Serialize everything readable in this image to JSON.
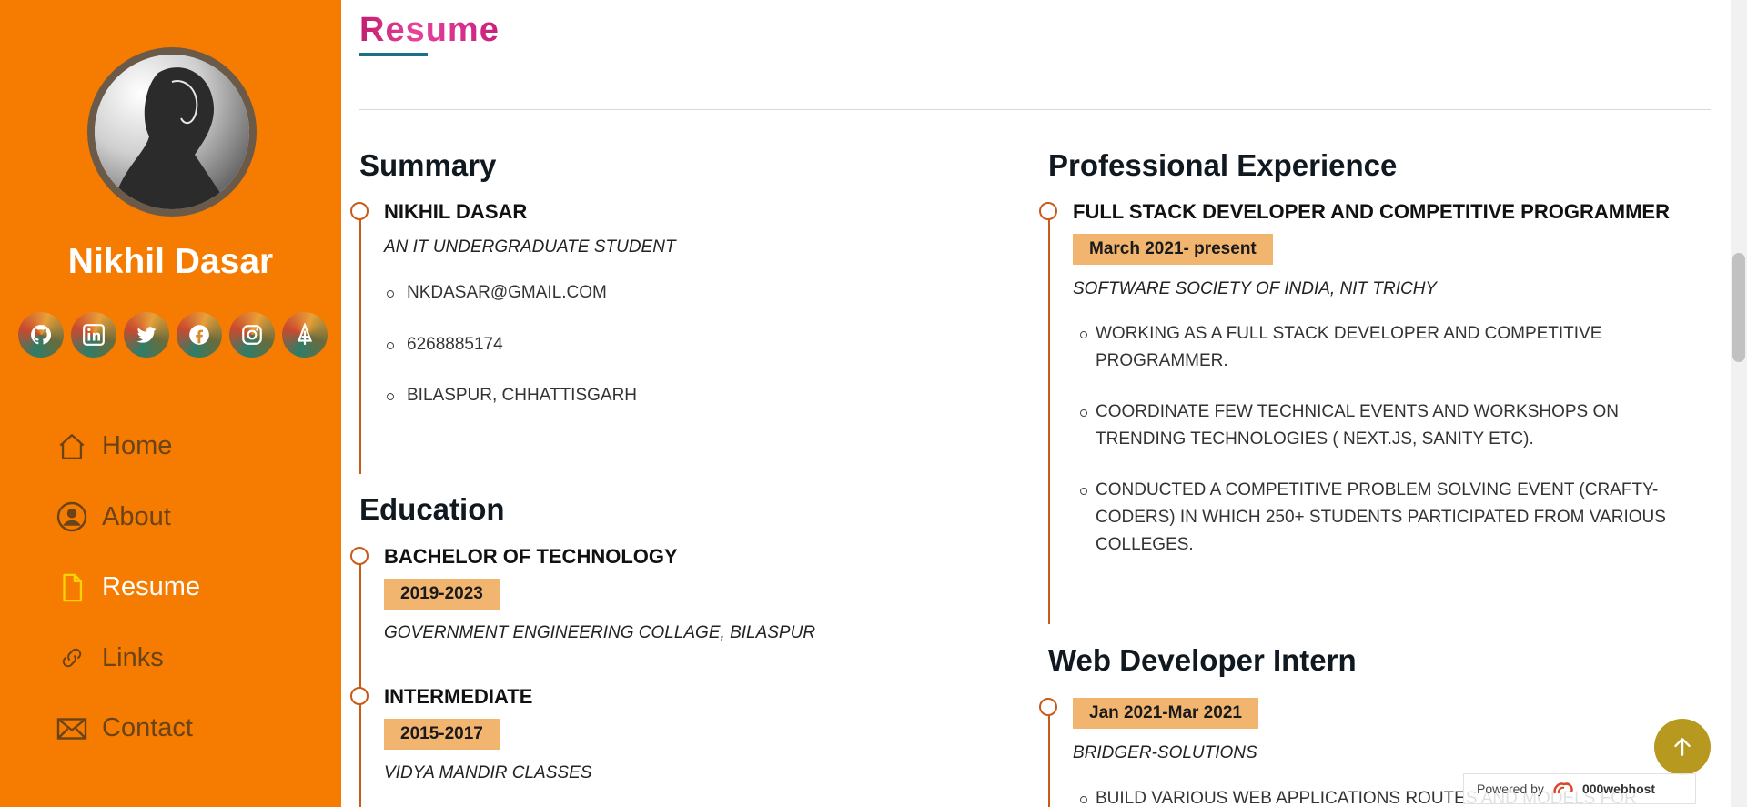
{
  "sidebar": {
    "name": "Nikhil Dasar",
    "socials": [
      {
        "icon": "github-icon"
      },
      {
        "icon": "linkedin-icon"
      },
      {
        "icon": "twitter-icon"
      },
      {
        "icon": "facebook-icon"
      },
      {
        "icon": "instagram-icon"
      },
      {
        "icon": "codechef-icon"
      }
    ],
    "nav": [
      {
        "label": "Home",
        "icon": "home-icon"
      },
      {
        "label": "About",
        "icon": "user-circle-icon"
      },
      {
        "label": "Resume",
        "icon": "file-icon",
        "active": true
      },
      {
        "label": "Links",
        "icon": "link-icon"
      },
      {
        "label": "Contact",
        "icon": "envelope-icon"
      }
    ]
  },
  "main": {
    "page_title": "Resume",
    "summary": {
      "heading": "Summary",
      "name": "NIKHIL DASAR",
      "tagline": "AN IT UNDERGRADUATE STUDENT",
      "details": [
        "NKDASAR@GMAIL.COM",
        "6268885174",
        "BILASPUR, CHHATTISGARH"
      ]
    },
    "education": {
      "heading": "Education",
      "items": [
        {
          "title": "BACHELOR OF TECHNOLOGY",
          "years": "2019-2023",
          "school": "GOVERNMENT ENGINEERING COLLAGE, BILASPUR"
        },
        {
          "title": "INTERMEDIATE",
          "years": "2015-2017",
          "school": "VIDYA MANDIR CLASSES"
        }
      ]
    },
    "experience": {
      "heading": "Professional Experience",
      "role": "FULL STACK DEVELOPER AND COMPETITIVE PROGRAMMER",
      "period": "March 2021- present",
      "org": "SOFTWARE SOCIETY OF INDIA, NIT TRICHY",
      "points": [
        [
          "WORKING AS A FULL STACK DEVELOPER AND COMPETITIVE",
          "PROGRAMMER."
        ],
        [
          "COORDINATE FEW TECHNICAL EVENTS AND WORKSHOPS ON",
          "TRENDING TECHNOLOGIES ( NEXT.JS, SANITY ETC)."
        ],
        [
          "CONDUCTED A COMPETITIVE PROBLEM SOLVING EVENT (CRAFTY-",
          "CODERS) IN WHICH 250+ STUDENTS PARTICIPATED FROM VARIOUS",
          "COLLEGES."
        ]
      ]
    },
    "intern": {
      "heading": "Web Developer Intern",
      "period": "Jan 2021-Mar 2021",
      "org": "BRIDGER-SOLUTIONS",
      "points": [
        [
          "BUILD VARIOUS WEB APPLICATIONS ROUTES AND MODELS FOR"
        ]
      ]
    }
  },
  "footer": {
    "powered_label": "Powered by",
    "powered_brand": "000webhost"
  },
  "colors": {
    "sidebar_bg": "#f57c00",
    "pill_bg": "#f1b56f",
    "timeline": "#c75b1a",
    "title_gradient": "#c21e6f"
  }
}
